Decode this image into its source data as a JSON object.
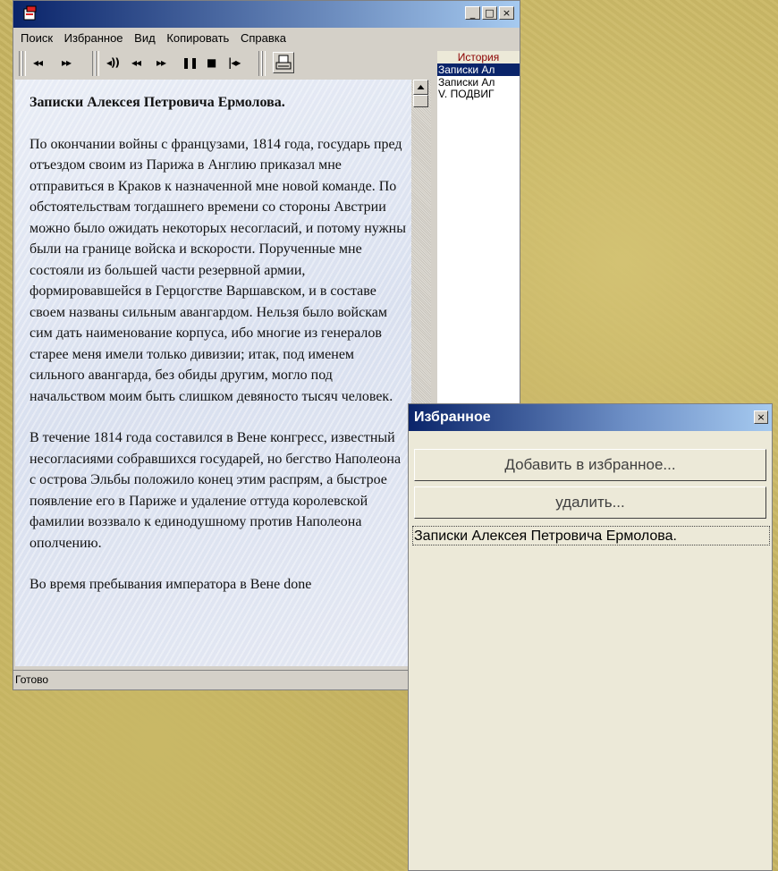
{
  "main_window": {
    "menu": [
      "Поиск",
      "Избранное",
      "Вид",
      "Копировать",
      "Справка"
    ],
    "win_controls": {
      "minimize": "_",
      "maximize": "□",
      "close": "×"
    },
    "toolbar": {
      "rewind": "◂◂",
      "forward": "▸▸",
      "volume": "◂))",
      "prev": "◂◂",
      "next": "▸▸",
      "pause": "❚❚",
      "stop": "■",
      "begin": "|◂▸"
    },
    "document": {
      "title": "Записки Алексея Петровича Ермолова.",
      "paragraphs": [
        "По окончании войны с французами, 1814 года, государь пред отъездом своим из Парижа в Англию приказал мне отправиться в Краков к назначенной мне новой команде. По обстоятельствам тогдашнего времени со стороны Австрии можно было ожидать некоторых несогласий, и потому нужны были на границе войска и вскорости. Порученные мне состояли из большей части резервной армии, формировавшейся в Герцогстве Варшавском, и в составе своем названы сильным авангардом. Нельзя было войскам сим дать наименование корпуса, ибо многие из генералов старее меня имели только дивизии; итак, под именем сильного авангарда, без обиды другим, могло под начальством моим быть слишком девяносто тысяч человек.",
        "В течение 1814 года составился в Вене конгресс, известный несогласиями собравшихся государей, но бегство Наполеона с острова Эльбы положило конец этим распрям, а быстрое появление его в Париже и удаление оттуда королевской фамилии воззвало к единодушному против Наполеона ополчению.",
        "Во время пребывания императора в Вене done"
      ]
    },
    "history": {
      "header": "История",
      "items": [
        "Записки Ал",
        "Записки Ал",
        "V. ПОДВИГ"
      ]
    },
    "status": "Готово"
  },
  "favorites": {
    "title": "Избранное",
    "close": "×",
    "add_label": "Добавить в избранное...",
    "delete_label": "удалить...",
    "items": [
      "Записки Алексея Петровича Ермолова."
    ]
  }
}
